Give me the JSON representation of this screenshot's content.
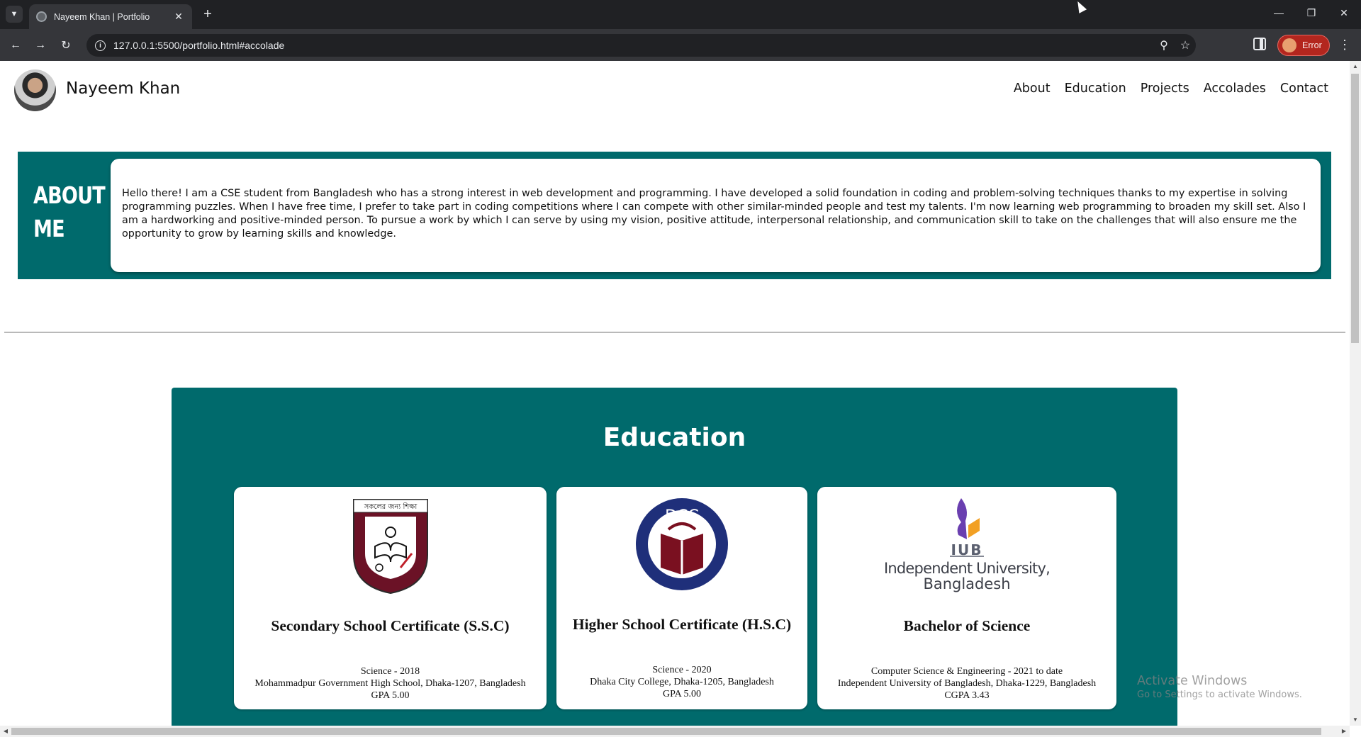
{
  "browser": {
    "tab_title": "Nayeem Khan | Portfolio",
    "new_tab_symbol": "+",
    "url": "127.0.0.1:5500/portfolio.html#accolade",
    "profile_label": "Error"
  },
  "site": {
    "name": "Nayeem Khan",
    "nav": [
      "About",
      "Education",
      "Projects",
      "Accolades",
      "Contact"
    ]
  },
  "about": {
    "title_line1": "ABOUT",
    "title_line2": "ME",
    "text": "Hello there! I am a CSE student from Bangladesh who has a strong interest in web development and programming. I have developed a solid foundation in coding and problem-solving techniques thanks to my expertise in solving programming puzzles. When I have free time, I prefer to take part in coding competitions where I can compete with other similar-minded people and test my talents. I'm now learning web programming to broaden my skill set. Also I am a hardworking and positive-minded person. To pursue a work by which I can serve by using my vision, positive attitude, interpersonal relationship, and communication skill to take on the challenges that will also ensure me the opportunity to grow by learning skills and knowledge."
  },
  "education": {
    "heading": "Education",
    "cards": [
      {
        "logo_text_top": "সকলের জন্য শিক্ষা",
        "degree": "Secondary School Certificate (S.S.C)",
        "line1": "Science - 2018",
        "line2": "Mohammadpur Government High School, Dhaka-1207, Bangladesh",
        "line3": "GPA 5.00"
      },
      {
        "logo_text_top": "DCC",
        "degree": "Higher School Certificate (H.S.C)",
        "line1": "Science - 2020",
        "line2": "Dhaka City College, Dhaka-1205, Bangladesh",
        "line3": "GPA 5.00"
      },
      {
        "logo_text_top": "IUB",
        "logo_text_bottom": "Independent University, Bangladesh",
        "degree": "Bachelor of Science",
        "line1": "Computer Science & Engineering - 2021 to date",
        "line2": "Independent University of Bangladesh, Dhaka-1229, Bangladesh",
        "line3": "CGPA 3.43"
      }
    ]
  },
  "watermark": {
    "line1": "Activate Windows",
    "line2": "Go to Settings to activate Windows."
  },
  "colors": {
    "teal": "#006a6c",
    "chrome_dark": "#202124",
    "chrome_toolbar": "#35363a",
    "error_chip": "#b3261e"
  },
  "icons": [
    "tab-list-icon",
    "favicon-icon",
    "close-icon",
    "plus-icon",
    "minimize-icon",
    "maximize-icon",
    "window-close-icon",
    "back-icon",
    "forward-icon",
    "reload-icon",
    "info-icon",
    "zoom-icon",
    "star-icon",
    "side-panel-icon",
    "more-menu-icon"
  ]
}
